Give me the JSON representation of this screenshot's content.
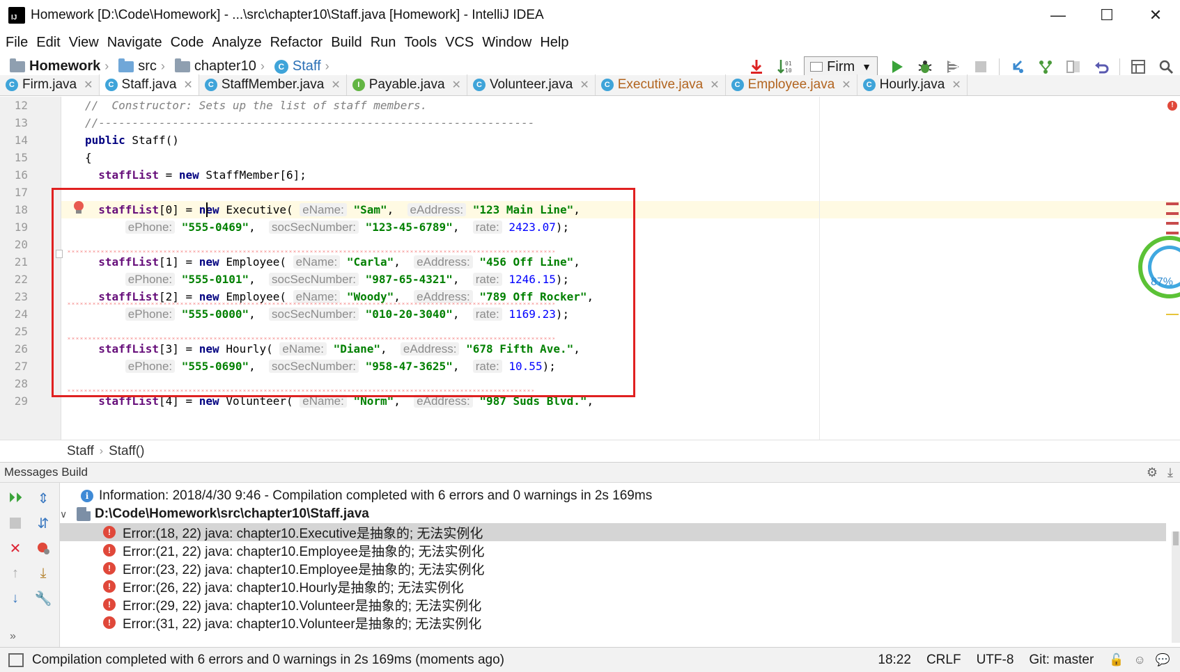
{
  "window": {
    "title": "Homework [D:\\Code\\Homework] - ...\\src\\chapter10\\Staff.java [Homework] - IntelliJ IDEA",
    "logo_text": "IJ",
    "minimize": "—",
    "maximize": "☐",
    "close": "✕"
  },
  "menu": [
    "File",
    "Edit",
    "View",
    "Navigate",
    "Code",
    "Analyze",
    "Refactor",
    "Build",
    "Run",
    "Tools",
    "VCS",
    "Window",
    "Help"
  ],
  "breadcrumb": {
    "project": "Homework",
    "src": "src",
    "package": "chapter10",
    "class": "Staff",
    "sep": "›"
  },
  "toolbar": {
    "run_config": "Firm",
    "icons": [
      "build-download-icon",
      "sort-icon",
      "run-icon",
      "debug-icon",
      "coverage-icon",
      "stop-icon",
      "vcs-update-icon",
      "vcs-push-icon",
      "compare-icon",
      "rollback-icon",
      "project-structure-icon",
      "search-icon"
    ]
  },
  "tabs": [
    {
      "label": "Firm.java",
      "icon": "C",
      "active": false,
      "modified": false
    },
    {
      "label": "Staff.java",
      "icon": "C",
      "active": true,
      "modified": false
    },
    {
      "label": "StaffMember.java",
      "icon": "C",
      "active": false,
      "modified": false
    },
    {
      "label": "Payable.java",
      "icon": "I",
      "active": false,
      "modified": false
    },
    {
      "label": "Volunteer.java",
      "icon": "C",
      "active": false,
      "modified": false
    },
    {
      "label": "Executive.java",
      "icon": "C",
      "active": false,
      "modified": true
    },
    {
      "label": "Employee.java",
      "icon": "C",
      "active": false,
      "modified": true
    },
    {
      "label": "Hourly.java",
      "icon": "C",
      "active": false,
      "modified": false
    }
  ],
  "editor": {
    "line_numbers": [
      "12",
      "13",
      "14",
      "15",
      "16",
      "17",
      "18",
      "19",
      "20",
      "21",
      "22",
      "23",
      "24",
      "25",
      "26",
      "27",
      "28",
      "29"
    ],
    "lines": {
      "l12": "//  Constructor: Sets up the list of staff members.",
      "l13": "//-----------------------------------------------------------------",
      "l14_kw": "public",
      "l14_rest": " Staff()",
      "l15": "{",
      "l16_field": "staffList",
      "l16_a": " = ",
      "l16_kw": "new",
      "l16_b": " StaffMember[6];"
    },
    "calls": [
      {
        "index": "0",
        "type": "Executive",
        "name": "\"Sam\"",
        "address": "\"123 Main Line\"",
        "phone": "\"555-0469\"",
        "ssn": "\"123-45-6789\"",
        "rate": "2423.07"
      },
      {
        "index": "1",
        "type": "Employee",
        "name": "\"Carla\"",
        "address": "\"456 Off Line\"",
        "phone": "\"555-0101\"",
        "ssn": "\"987-65-4321\"",
        "rate": "1246.15"
      },
      {
        "index": "2",
        "type": "Employee",
        "name": "\"Woody\"",
        "address": "\"789 Off Rocker\"",
        "phone": "\"555-0000\"",
        "ssn": "\"010-20-3040\"",
        "rate": "1169.23"
      },
      {
        "index": "3",
        "type": "Hourly",
        "name": "\"Diane\"",
        "address": "\"678 Fifth Ave.\"",
        "phone": "\"555-0690\"",
        "ssn": "\"958-47-3625\"",
        "rate": "10.55"
      },
      {
        "index": "4",
        "type": "Volunteer",
        "name": "\"Norm\"",
        "address": "\"987 Suds Blvd.\""
      }
    ],
    "hints": {
      "name": "eName:",
      "address": "eAddress:",
      "phone": "ePhone:",
      "ssn": "socSecNumber:",
      "rate": "rate:"
    },
    "performance_percent": "87%"
  },
  "editor_breadcrumb": [
    "Staff",
    "Staff()"
  ],
  "messages": {
    "header": "Messages Build",
    "info": "Information: 2018/4/30 9:46 - Compilation completed with 6 errors and 0 warnings in 2s 169ms",
    "file": "D:\\Code\\Homework\\src\\chapter10\\Staff.java",
    "errors": [
      "Error:(18, 22)  java: chapter10.Executive是抽象的; 无法实例化",
      "Error:(21, 22)  java: chapter10.Employee是抽象的; 无法实例化",
      "Error:(23, 22)  java: chapter10.Employee是抽象的; 无法实例化",
      "Error:(26, 22)  java: chapter10.Hourly是抽象的; 无法实例化",
      "Error:(29, 22)  java: chapter10.Volunteer是抽象的; 无法实例化",
      "Error:(31, 22)  java: chapter10.Volunteer是抽象的; 无法实例化"
    ]
  },
  "status": {
    "message": "Compilation completed with 6 errors and 0 warnings in 2s 169ms (moments ago)",
    "position": "18:22",
    "line_ending": "CRLF",
    "encoding": "UTF-8",
    "git": "Git: master"
  },
  "colors": {
    "error": "#e0483a",
    "highlight_box": "#e02020",
    "keyword": "#000080",
    "string": "#008000",
    "number": "#0000ff",
    "field": "#660e7a"
  }
}
